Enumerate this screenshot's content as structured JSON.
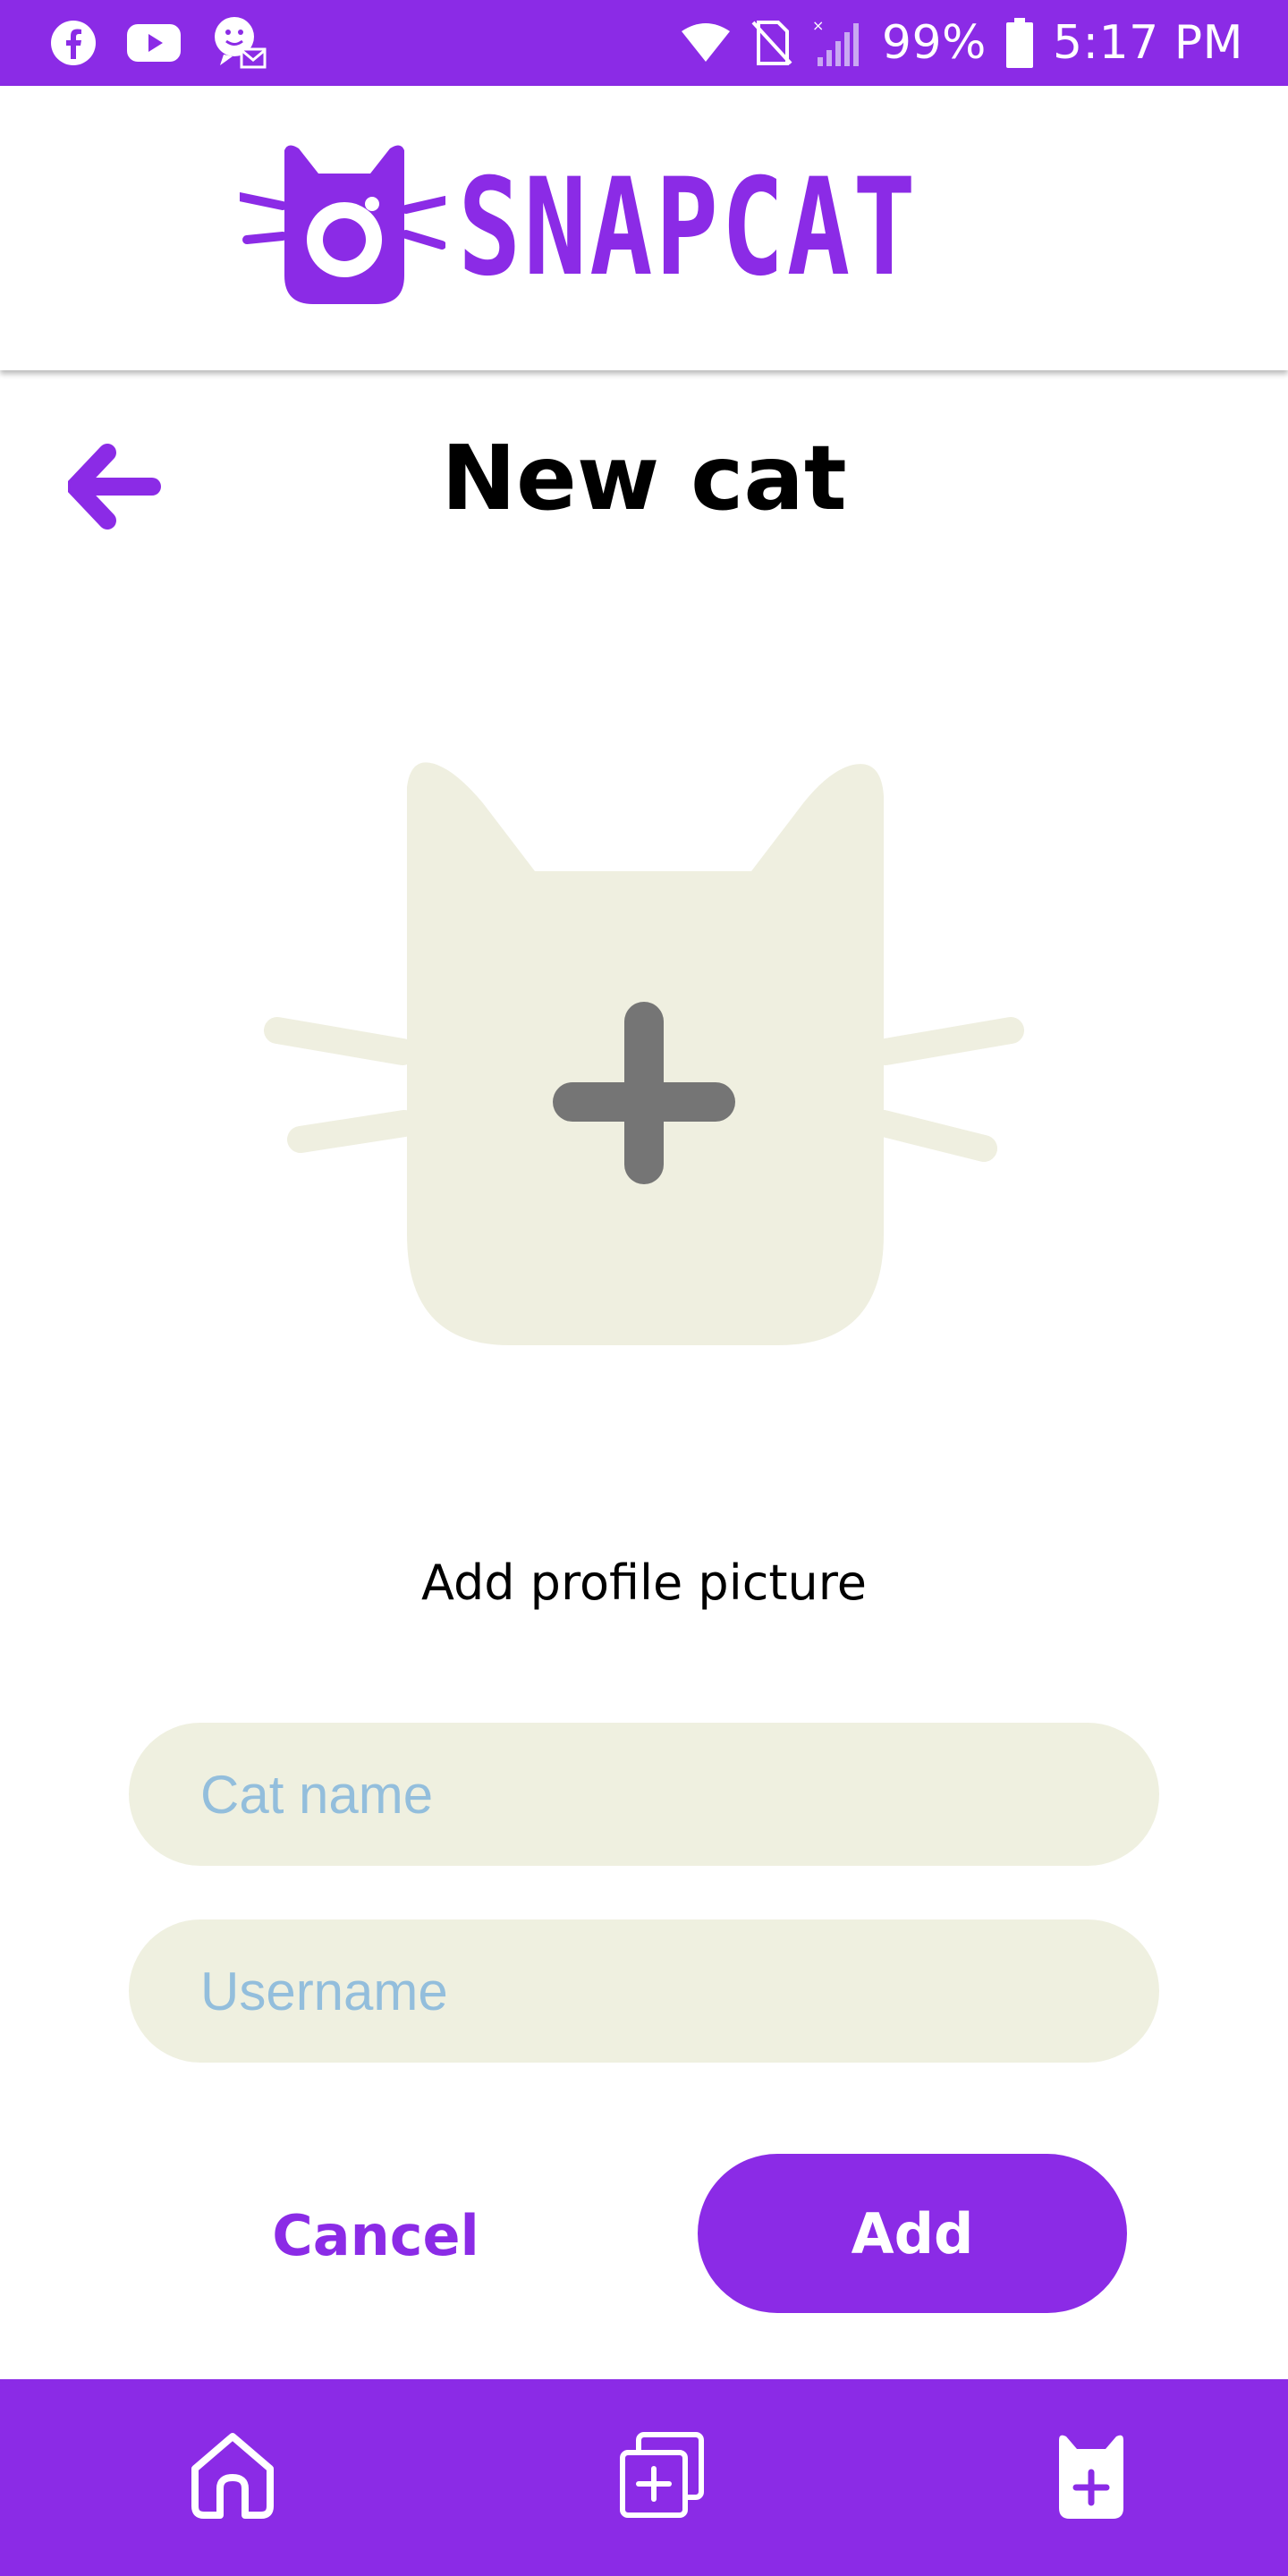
{
  "status_bar": {
    "left_icons": [
      "facebook-icon",
      "youtube-icon",
      "chat-mail-icon"
    ],
    "right_icons": [
      "wifi-icon",
      "no-sim-icon",
      "signal-icon",
      "battery-icon"
    ],
    "battery": "99%",
    "time": "5:17 PM"
  },
  "header": {
    "logo_text": "SNAPCAT",
    "logo_icon": "cat-camera-icon"
  },
  "page": {
    "back_icon": "arrow-left-icon",
    "title": "New cat"
  },
  "profile_picture": {
    "icon": "cat-add-icon",
    "caption": "Add profile picture"
  },
  "form": {
    "cat_name": {
      "value": "",
      "placeholder": "Cat name"
    },
    "username": {
      "value": "",
      "placeholder": "Username"
    }
  },
  "actions": {
    "cancel_label": "Cancel",
    "add_label": "Add"
  },
  "bottom_nav": {
    "items": [
      {
        "name": "home",
        "icon": "home-icon"
      },
      {
        "name": "new-post",
        "icon": "add-photo-icon"
      },
      {
        "name": "new-cat",
        "icon": "add-cat-icon"
      }
    ]
  },
  "colors": {
    "brand": "#8b2be6",
    "field_bg": "#eff0e0",
    "placeholder": "#93bedc",
    "cat_fill": "#efefe0",
    "plus": "#757575"
  }
}
